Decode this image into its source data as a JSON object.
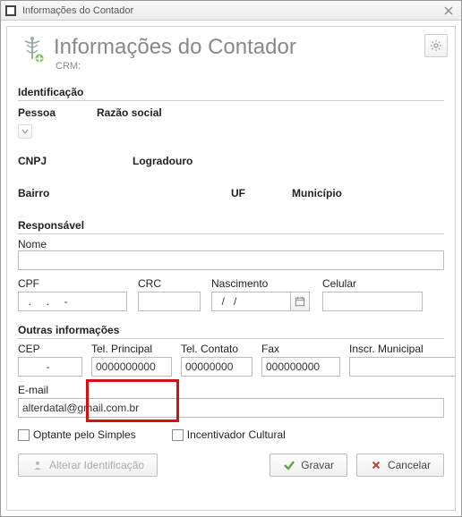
{
  "window": {
    "title": "Informações do Contador"
  },
  "header": {
    "title": "Informações do Contador",
    "subtitle": "CRM:"
  },
  "sections": {
    "identificacao": {
      "heading": "Identificação",
      "labels": {
        "pessoa": "Pessoa",
        "razao_social": "Razão social",
        "cnpj": "CNPJ",
        "logradouro": "Logradouro",
        "bairro": "Bairro",
        "uf": "UF",
        "municipio": "Município"
      }
    },
    "responsavel": {
      "heading": "Responsável",
      "labels": {
        "nome": "Nome",
        "cpf": "CPF",
        "crc": "CRC",
        "nascimento": "Nascimento",
        "celular": "Celular"
      },
      "values": {
        "nome": "",
        "cpf": "  .     .     -",
        "crc": "",
        "nascimento": "  /   /",
        "celular": ""
      }
    },
    "outras": {
      "heading": "Outras informações",
      "labels": {
        "cep": "CEP",
        "tel_principal": "Tel. Principal",
        "tel_contato": "Tel. Contato",
        "fax": "Fax",
        "inscr_municipal": "Inscr. Municipal",
        "email": "E-mail"
      },
      "values": {
        "cep": "        -",
        "tel_principal": "0000000000",
        "tel_contato": "00000000",
        "fax": "000000000",
        "inscr_municipal": "",
        "email": "alterdatal@gmail.com.br"
      }
    }
  },
  "checkboxes": {
    "optante_simples": "Optante pelo Simples",
    "incentivador_cultural": "Incentivador Cultural"
  },
  "buttons": {
    "alterar": "Alterar Identificação",
    "gravar": "Gravar",
    "cancelar": "Cancelar"
  }
}
